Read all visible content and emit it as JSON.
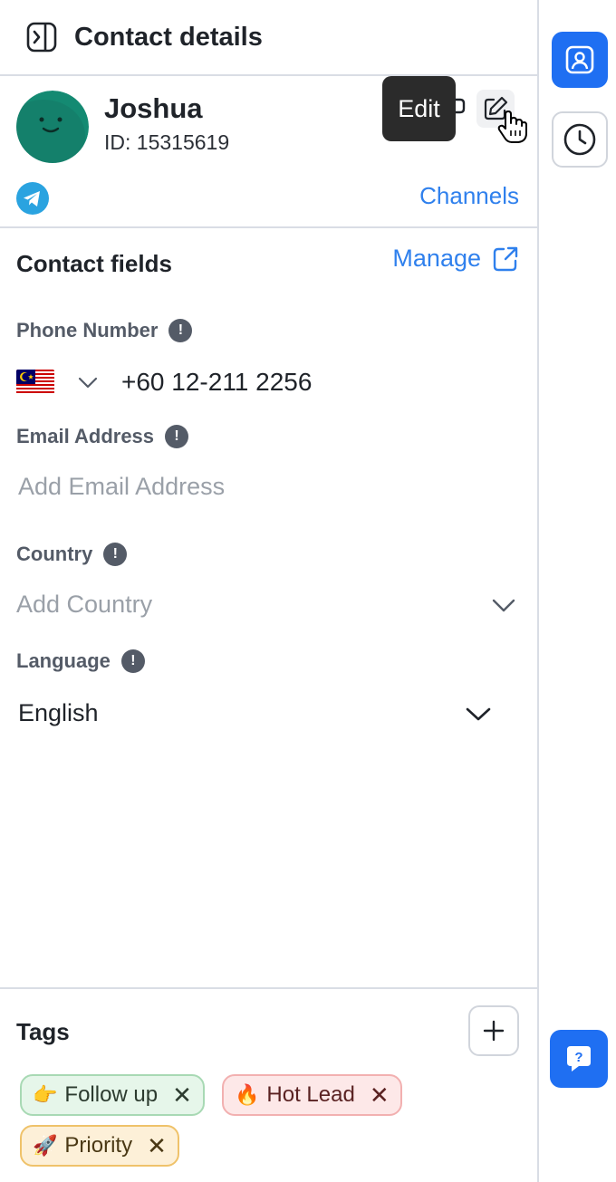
{
  "header": {
    "title": "Contact details"
  },
  "contact": {
    "name": "Joshua",
    "id": "ID: 15315619",
    "tooltip": "Edit",
    "channels_label": "Channels"
  },
  "fields": {
    "title": "Contact fields",
    "manage_label": "Manage",
    "phone": {
      "label": "Phone Number",
      "value": "+60 12-211 2256"
    },
    "email": {
      "label": "Email Address",
      "placeholder": "Add Email Address"
    },
    "country": {
      "label": "Country",
      "placeholder": "Add Country"
    },
    "language": {
      "label": "Language",
      "value": "English"
    }
  },
  "tags": {
    "title": "Tags",
    "items": [
      {
        "emoji": "👉",
        "label": "Follow up"
      },
      {
        "emoji": "🔥",
        "label": "Hot Lead"
      },
      {
        "emoji": "🚀",
        "label": "Priority"
      }
    ]
  },
  "colors": {
    "accent": "#2f80ed",
    "rail_active": "#1f6ff2",
    "avatar": "#148a72"
  }
}
